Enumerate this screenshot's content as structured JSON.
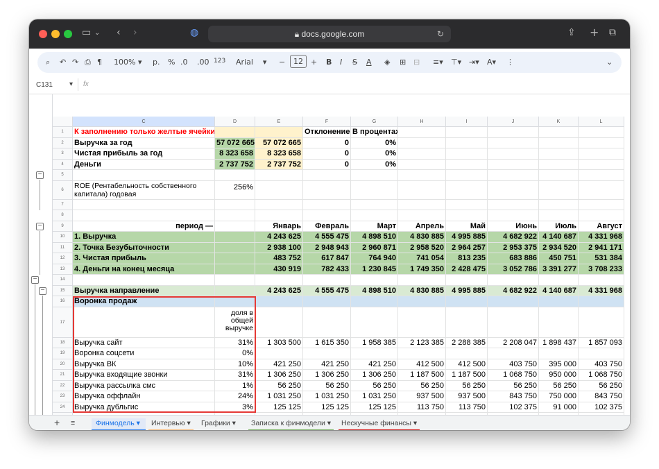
{
  "browser": {
    "url": "docs.google.com"
  },
  "toolbar": {
    "zoom": "100%",
    "currency": "р.",
    "percent": "%",
    "dec_minus": ".0",
    "dec_plus": ".00",
    "format": "123",
    "font": "Arial",
    "font_size": "12"
  },
  "formula_bar": {
    "cell_ref": "C131",
    "fx": "fx"
  },
  "columns": [
    "C",
    "D",
    "E",
    "F",
    "G",
    "H",
    "I",
    "J",
    "K",
    "L"
  ],
  "rows": [
    {
      "n": "1",
      "c": "К заполнению только желтые ячейки!",
      "d": "",
      "vals": [
        "",
        "Отклонение",
        "В процентах",
        "",
        "",
        "",
        "",
        ""
      ]
    },
    {
      "n": "2",
      "c": "Выручка за год",
      "d": "57 072 665",
      "vals": [
        "57 072 665",
        "0",
        "0%",
        "",
        "",
        "",
        "",
        ""
      ]
    },
    {
      "n": "3",
      "c": "Чистая прибыль за год",
      "d": "8 323 658",
      "vals": [
        "8 323 658",
        "0",
        "0%",
        "",
        "",
        "",
        "",
        ""
      ]
    },
    {
      "n": "4",
      "c": "Деньги",
      "d": "2 737 752",
      "vals": [
        "2 737 752",
        "0",
        "0%",
        "",
        "",
        "",
        "",
        ""
      ]
    },
    {
      "n": "5",
      "c": "",
      "d": "",
      "vals": [
        "",
        "",
        "",
        "",
        "",
        "",
        "",
        ""
      ]
    },
    {
      "n": "6",
      "c": "ROE (Рентабельность собственного капитала) годовая",
      "d": "256%",
      "vals": [
        "",
        "",
        "",
        "",
        "",
        "",
        "",
        ""
      ]
    },
    {
      "n": "7",
      "c": "",
      "d": "",
      "vals": [
        "",
        "",
        "",
        "",
        "",
        "",
        "",
        ""
      ]
    },
    {
      "n": "8",
      "c": "",
      "d": "",
      "vals": [
        "",
        "",
        "",
        "",
        "",
        "",
        "",
        ""
      ]
    },
    {
      "n": "9",
      "c": "период —",
      "d": "",
      "vals": [
        "Январь",
        "Февраль",
        "Март",
        "Апрель",
        "Май",
        "Июнь",
        "Июль",
        "Август"
      ]
    },
    {
      "n": "10",
      "c": "1. Выручка",
      "d": "",
      "vals": [
        "4 243 625",
        "4 555 475",
        "4 898 510",
        "4 830 885",
        "4 995 885",
        "4 682 922",
        "4 140 687",
        "4 331 968"
      ]
    },
    {
      "n": "11",
      "c": "2. Точка Безубыточности",
      "d": "",
      "vals": [
        "2 938 100",
        "2 948 943",
        "2 960 871",
        "2 958 520",
        "2 964 257",
        "2 953 375",
        "2 934 520",
        "2 941 171"
      ]
    },
    {
      "n": "12",
      "c": "3. Чистая прибыль",
      "d": "",
      "vals": [
        "483 752",
        "617 847",
        "764 940",
        "741 054",
        "813 235",
        "683 886",
        "450 751",
        "531 384"
      ]
    },
    {
      "n": "13",
      "c": "4. Деньги на конец месяца",
      "d": "",
      "vals": [
        "430 919",
        "782 433",
        "1 230 845",
        "1 749 350",
        "2 428 475",
        "3 052 786",
        "3 391 277",
        "3 708 233"
      ]
    },
    {
      "n": "14",
      "c": "",
      "d": "",
      "vals": [
        "",
        "",
        "",
        "",
        "",
        "",
        "",
        ""
      ]
    },
    {
      "n": "15",
      "c": "Выручка направление",
      "d": "",
      "vals": [
        "4 243 625",
        "4 555 475",
        "4 898 510",
        "4 830 885",
        "4 995 885",
        "4 682 922",
        "4 140 687",
        "4 331 968"
      ]
    },
    {
      "n": "16",
      "c": "Воронка продаж",
      "d": "",
      "vals": [
        "",
        "",
        "",
        "",
        "",
        "",
        "",
        ""
      ]
    },
    {
      "n": "17",
      "c": "",
      "d": "доля в общей выручке",
      "vals": [
        "",
        "",
        "",
        "",
        "",
        "",
        "",
        ""
      ]
    },
    {
      "n": "18",
      "c": "Выручка сайт",
      "d": "31%",
      "vals": [
        "1 303 500",
        "1 615 350",
        "1 958 385",
        "2 123 385",
        "2 288 385",
        "2 208 047",
        "1 898 437",
        "1 857 093"
      ]
    },
    {
      "n": "19",
      "c": "Воронка соцсети",
      "d": "0%",
      "vals": [
        "",
        "",
        "",
        "",
        "",
        "",
        "",
        ""
      ]
    },
    {
      "n": "20",
      "c": "Выручка ВК",
      "d": "10%",
      "vals": [
        "421 250",
        "421 250",
        "421 250",
        "412 500",
        "412 500",
        "403 750",
        "395 000",
        "403 750"
      ]
    },
    {
      "n": "21",
      "c": "Выручка входящие звонки",
      "d": "31%",
      "vals": [
        "1 306 250",
        "1 306 250",
        "1 306 250",
        "1 187 500",
        "1 187 500",
        "1 068 750",
        "950 000",
        "1 068 750"
      ]
    },
    {
      "n": "22",
      "c": "Выручка рассылка смс",
      "d": "1%",
      "vals": [
        "56 250",
        "56 250",
        "56 250",
        "56 250",
        "56 250",
        "56 250",
        "56 250",
        "56 250"
      ]
    },
    {
      "n": "23",
      "c": "Выручка оффлайн",
      "d": "24%",
      "vals": [
        "1 031 250",
        "1 031 250",
        "1 031 250",
        "937 500",
        "937 500",
        "843 750",
        "750 000",
        "843 750"
      ]
    },
    {
      "n": "24",
      "c": "Выручка дубльгис",
      "d": "3%",
      "vals": [
        "125 125",
        "125 125",
        "125 125",
        "113 750",
        "113 750",
        "102 375",
        "91 000",
        "102 375"
      ]
    },
    {
      "n": "25",
      "c": "",
      "d": "",
      "vals": [
        "",
        "",
        "",
        "",
        "",
        "",
        "",
        ""
      ]
    },
    {
      "n": "26",
      "c": "",
      "d": "",
      "vals": [
        "",
        "",
        "",
        "",
        "",
        "",
        "",
        ""
      ]
    }
  ],
  "sheet_tabs": [
    "Финмодель",
    "Интервью",
    "Графики",
    "Записка к финмодели",
    "Нескучные финансы"
  ],
  "colors": {
    "green": "#b6d7a8",
    "yellow": "#fff2cc",
    "blue": "#cfe2f3",
    "red": "#ff0000",
    "highlight_border": "#e53935"
  }
}
